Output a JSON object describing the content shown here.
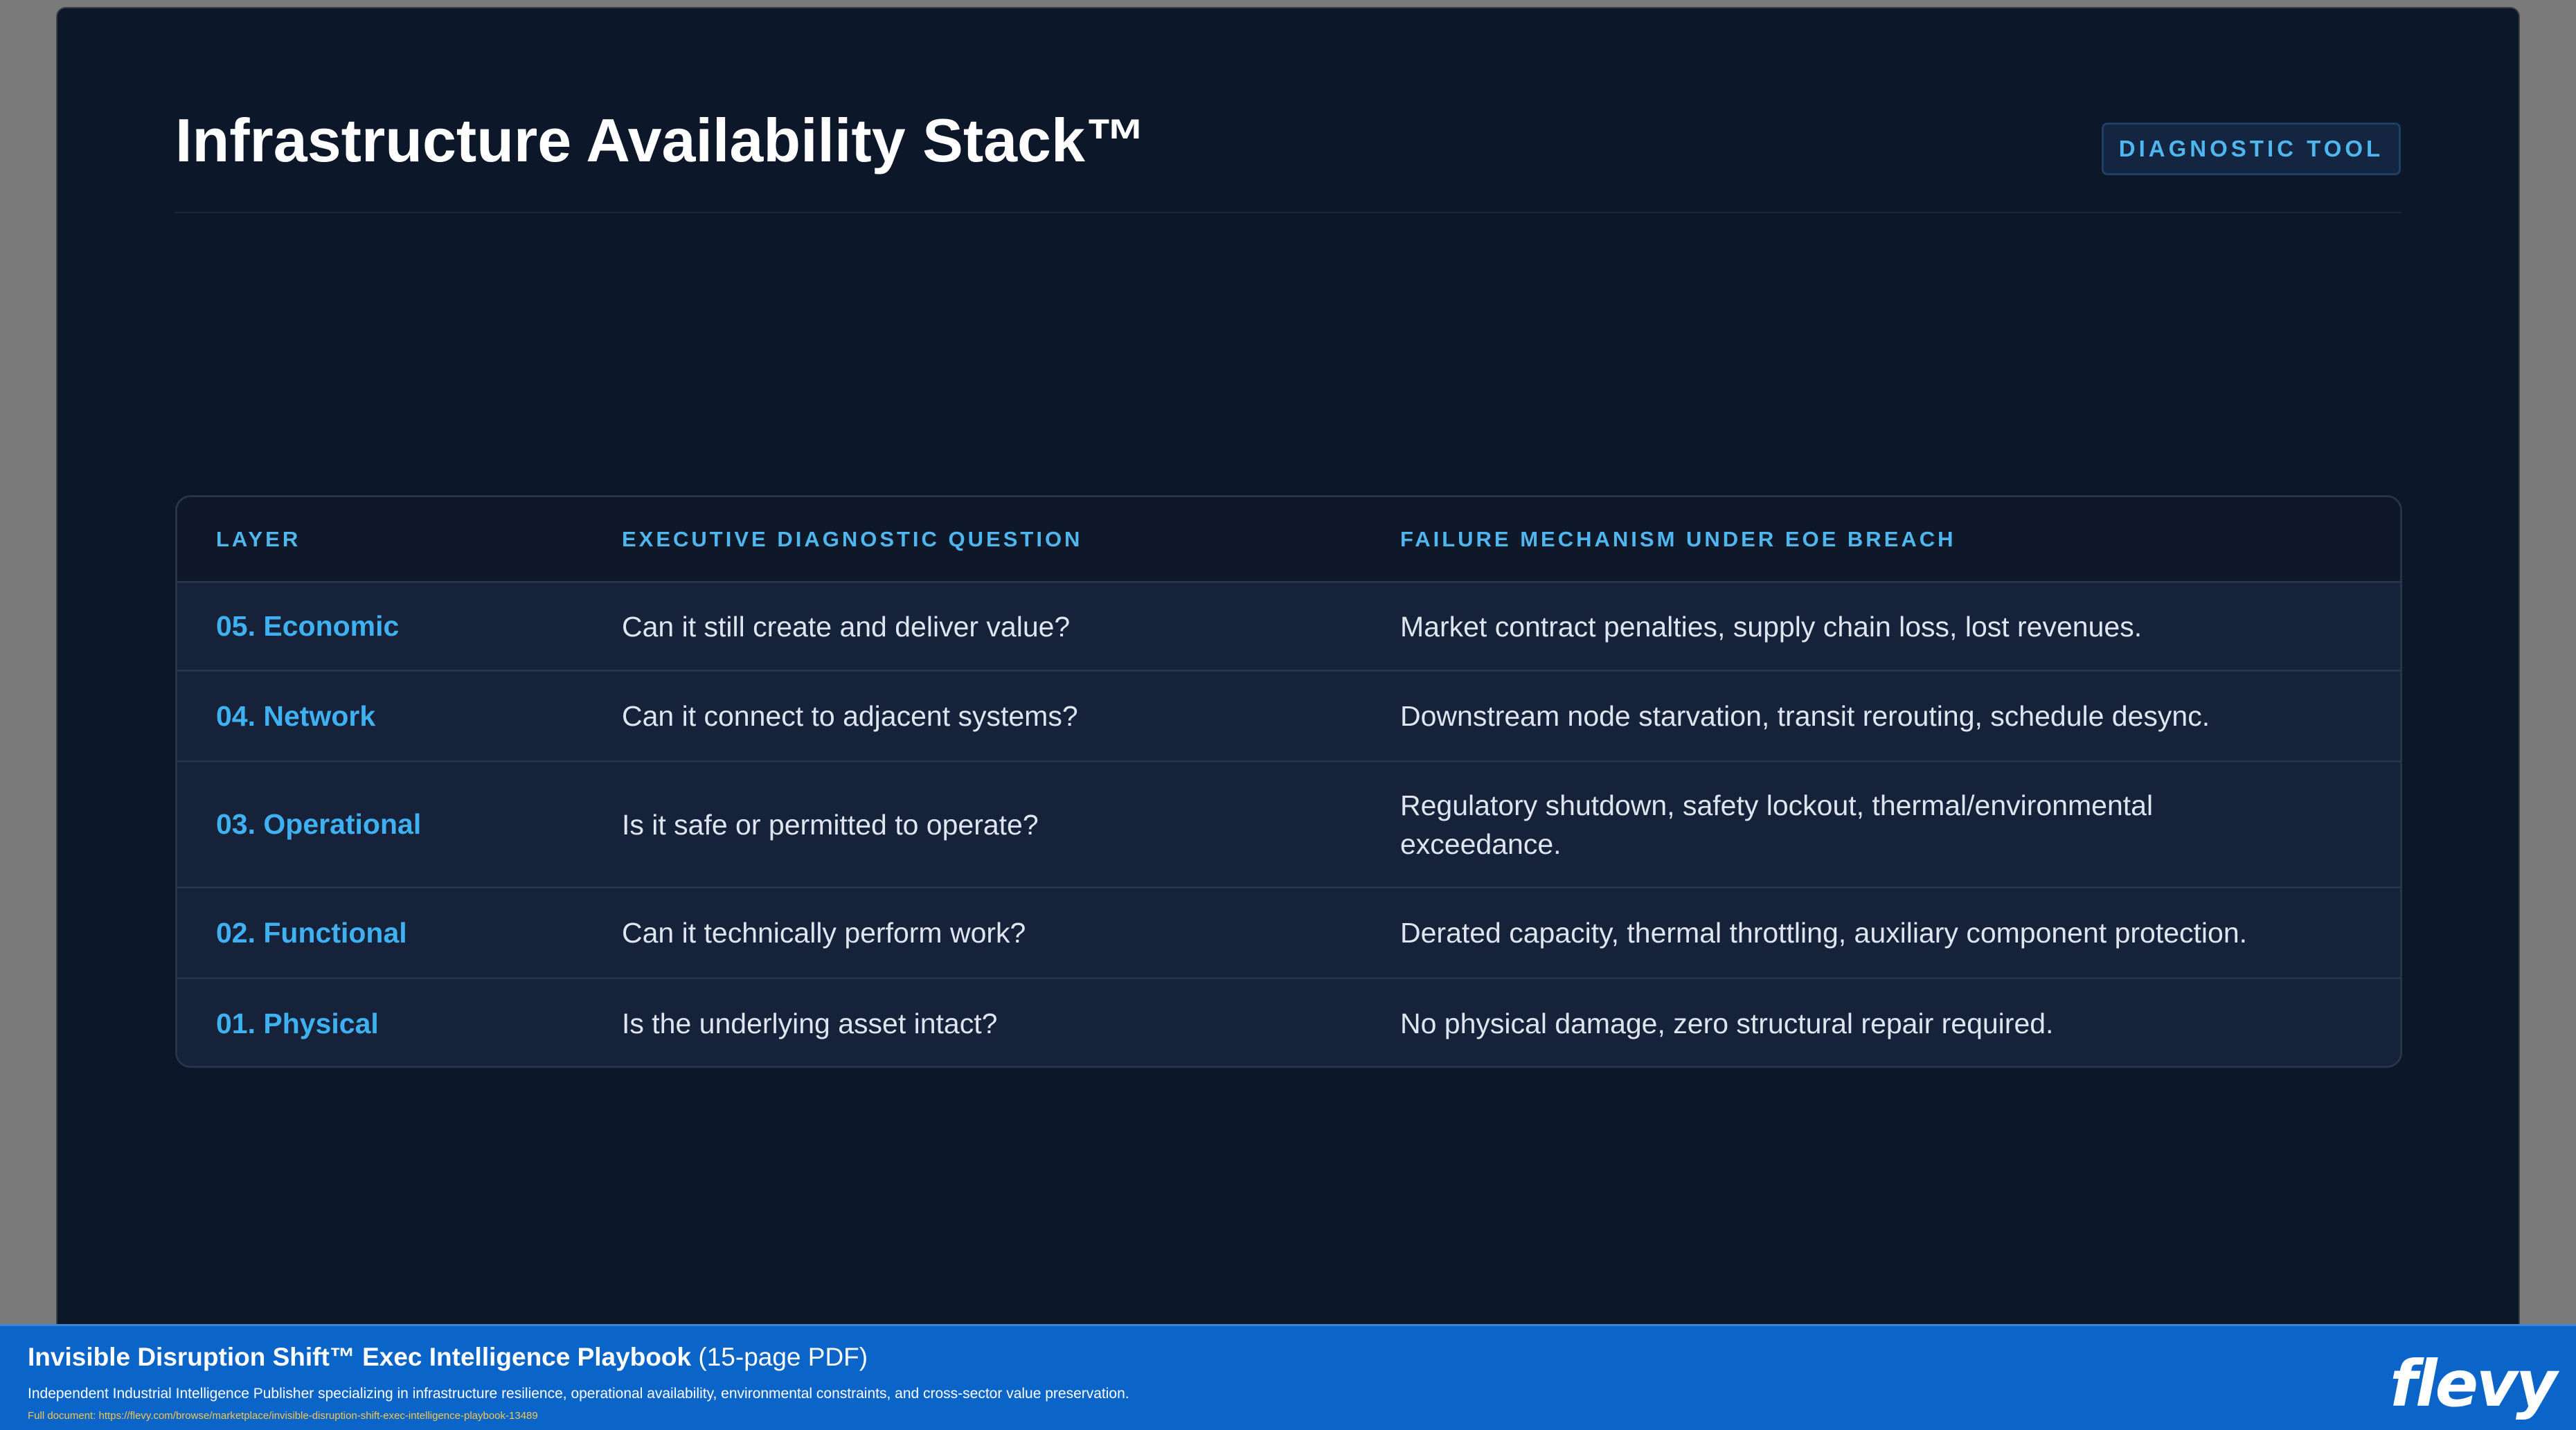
{
  "slide": {
    "title": "Infrastructure Availability Stack™",
    "badge": "DIAGNOSTIC TOOL"
  },
  "table": {
    "headers": [
      "LAYER",
      "EXECUTIVE DIAGNOSTIC QUESTION",
      "FAILURE MECHANISM UNDER EOE BREACH"
    ],
    "rows": [
      {
        "layer": "05. Economic",
        "question": "Can it still create and deliver value?",
        "failure": "Market contract penalties, supply chain loss, lost revenues."
      },
      {
        "layer": "04. Network",
        "question": "Can it connect to adjacent systems?",
        "failure": "Downstream node starvation, transit rerouting, schedule desync."
      },
      {
        "layer": "03. Operational",
        "question": "Is it safe or permitted to operate?",
        "failure": "Regulatory shutdown, safety lockout, thermal/environmental exceedance."
      },
      {
        "layer": "02. Functional",
        "question": "Can it technically perform work?",
        "failure": "Derated capacity, thermal throttling, auxiliary component protection."
      },
      {
        "layer": "01. Physical",
        "question": "Is the underlying asset intact?",
        "failure": "No physical damage, zero structural repair required."
      }
    ]
  },
  "footer": {
    "title": "Invisible Disruption Shift™ Exec Intelligence Playbook",
    "pages": "(15-page PDF)",
    "description": "Independent Industrial Intelligence Publisher specializing in infrastructure resilience, operational availability, environmental constraints, and cross-sector value preservation.",
    "link": "Full document: https://flevy.com/browse/marketplace/invisible-disruption-shift-exec-intelligence-playbook-13489",
    "logo": "flevy"
  },
  "colors": {
    "slide_background": "#0d172a",
    "accent": "#4fb6ee",
    "footer_background": "#0b64c8"
  }
}
